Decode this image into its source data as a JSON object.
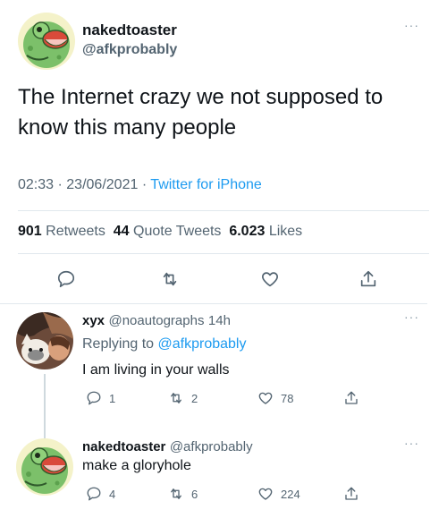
{
  "main": {
    "name": "nakedtoaster",
    "handle": "@afkprobably",
    "more": "···",
    "text_line1": "The Internet crazy we not supposed to",
    "text_line2": "know this many people",
    "time": "02:33",
    "date": "23/06/2021",
    "source": "Twitter for iPhone",
    "sep": "·",
    "retweets_count": "901",
    "retweets_label": "Retweets",
    "quotes_count": "44",
    "quotes_label": "Quote Tweets",
    "likes_count": "6.023",
    "likes_label": "Likes"
  },
  "reply1": {
    "name": "xyx",
    "handle": "@noautographs",
    "time": "14h",
    "replying_prefix": "Replying to",
    "replying_to": "@afkprobably",
    "text": "I am living in your walls",
    "replies": "1",
    "retweets": "2",
    "likes": "78",
    "more": "···"
  },
  "reply2": {
    "name": "nakedtoaster",
    "handle": "@afkprobably",
    "text": "make a gloryhole",
    "replies": "4",
    "retweets": "6",
    "likes": "224",
    "more": "···"
  },
  "colors": {
    "link": "#1d9bf0",
    "secondary": "#536471",
    "divider": "#e1e8ed"
  },
  "icons": {
    "reply": "speech-bubble-icon",
    "retweet": "retweet-icon",
    "like": "heart-icon",
    "share": "share-icon"
  }
}
